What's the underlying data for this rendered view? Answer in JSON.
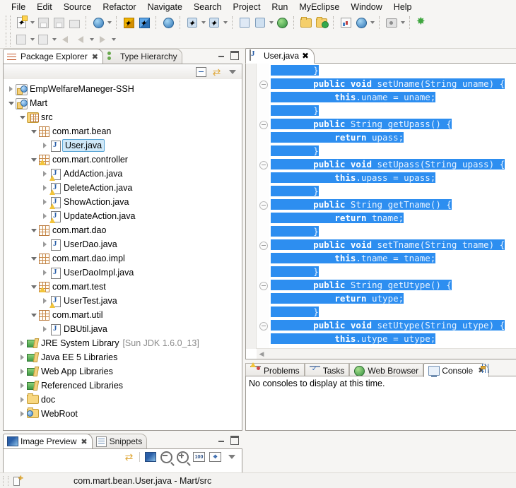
{
  "menubar": {
    "items": [
      "File",
      "Edit",
      "Source",
      "Refactor",
      "Navigate",
      "Search",
      "Project",
      "Run",
      "MyEclipse",
      "Window",
      "Help"
    ]
  },
  "toolbar": {
    "row1": [
      {
        "name": "new-wizard-button",
        "icon": "new-file-icon",
        "dropdown": true
      },
      {
        "name": "save-button",
        "icon": "save-icon",
        "dropdown": false
      },
      {
        "name": "save-all-button",
        "icon": "save-all-icon",
        "dropdown": false
      },
      {
        "name": "print-button",
        "icon": "print-icon",
        "dropdown": false
      },
      {
        "name": "build-button",
        "icon": "build-icon",
        "dropdown": true
      },
      {
        "name": "deploy-yellow-button",
        "icon": "yellow-cube-icon",
        "dropdown": false
      },
      {
        "name": "deploy-blue-button",
        "icon": "blue-cube-icon",
        "dropdown": false
      },
      {
        "name": "web-20-button",
        "icon": "web20-icon",
        "dropdown": false
      },
      {
        "name": "run-as-button",
        "icon": "run-person-icon",
        "dropdown": true
      },
      {
        "name": "debug-as-button",
        "icon": "debug-person-icon",
        "dropdown": true
      },
      {
        "name": "open-type-button",
        "icon": "open-type-icon",
        "dropdown": false
      },
      {
        "name": "run-server-button",
        "icon": "run-server-icon",
        "dropdown": true
      },
      {
        "name": "open-browser-button",
        "icon": "globe-icon",
        "dropdown": false
      },
      {
        "name": "open-resource-button",
        "icon": "open-folder-icon",
        "dropdown": false
      },
      {
        "name": "new-folder-button",
        "icon": "folder-plus-icon",
        "dropdown": false
      },
      {
        "name": "report-button",
        "icon": "report-icon",
        "dropdown": false
      },
      {
        "name": "browser-config-button",
        "icon": "globe-config-icon",
        "dropdown": true
      },
      {
        "name": "snapshot-button",
        "icon": "camera-icon",
        "dropdown": true
      },
      {
        "name": "myeclipse-button",
        "icon": "sparkle-icon",
        "dropdown": false
      }
    ],
    "row2": [
      {
        "name": "quick-fix-button",
        "icon": "quickfix-icon",
        "dropdown": true
      },
      {
        "name": "next-annotation-button",
        "icon": "annotation-icon",
        "dropdown": true
      },
      {
        "name": "back-history-button",
        "icon": "back-arrow-icon",
        "dropdown": false
      },
      {
        "name": "back-button",
        "icon": "left-arrow-icon",
        "dropdown": true
      },
      {
        "name": "forward-button",
        "icon": "right-arrow-icon",
        "dropdown": true
      }
    ]
  },
  "package_explorer": {
    "tabs": [
      {
        "label": "Package Explorer",
        "icon": "package-explorer-icon",
        "active": true,
        "closable": true
      },
      {
        "label": "Type Hierarchy",
        "icon": "type-hierarchy-icon",
        "active": false,
        "closable": false
      }
    ],
    "toolbar": [
      {
        "name": "collapse-all-button",
        "icon": "collapse-all-icon"
      },
      {
        "name": "link-with-editor-button",
        "icon": "link-editor-icon"
      },
      {
        "name": "view-menu-button",
        "icon": "view-menu-icon"
      }
    ],
    "tree": [
      {
        "label": "EmpWelfareManeger-SSH",
        "indent": 0,
        "twist": "closed",
        "icon": "java-project-icon",
        "selected": false,
        "sub": ""
      },
      {
        "label": "Mart",
        "indent": 0,
        "twist": "open",
        "icon": "java-project-icon",
        "selected": false,
        "sub": ""
      },
      {
        "label": "src",
        "indent": 1,
        "twist": "open",
        "icon": "source-folder-icon",
        "selected": false,
        "sub": ""
      },
      {
        "label": "com.mart.bean",
        "indent": 2,
        "twist": "open",
        "icon": "package-icon",
        "selected": false,
        "sub": ""
      },
      {
        "label": "User.java",
        "indent": 3,
        "twist": "closed",
        "icon": "java-file-icon",
        "selected": true,
        "sub": ""
      },
      {
        "label": "com.mart.controller",
        "indent": 2,
        "twist": "open",
        "icon": "package-warning-icon",
        "selected": false,
        "sub": ""
      },
      {
        "label": "AddAction.java",
        "indent": 3,
        "twist": "closed",
        "icon": "java-file-warning-icon",
        "selected": false,
        "sub": ""
      },
      {
        "label": "DeleteAction.java",
        "indent": 3,
        "twist": "closed",
        "icon": "java-file-warning-icon",
        "selected": false,
        "sub": ""
      },
      {
        "label": "ShowAction.java",
        "indent": 3,
        "twist": "closed",
        "icon": "java-file-warning-icon",
        "selected": false,
        "sub": ""
      },
      {
        "label": "UpdateAction.java",
        "indent": 3,
        "twist": "closed",
        "icon": "java-file-warning-icon",
        "selected": false,
        "sub": ""
      },
      {
        "label": "com.mart.dao",
        "indent": 2,
        "twist": "open",
        "icon": "package-icon",
        "selected": false,
        "sub": ""
      },
      {
        "label": "UserDao.java",
        "indent": 3,
        "twist": "closed",
        "icon": "java-file-icon",
        "selected": false,
        "sub": ""
      },
      {
        "label": "com.mart.dao.impl",
        "indent": 2,
        "twist": "open",
        "icon": "package-icon",
        "selected": false,
        "sub": ""
      },
      {
        "label": "UserDaoImpl.java",
        "indent": 3,
        "twist": "closed",
        "icon": "java-file-icon",
        "selected": false,
        "sub": ""
      },
      {
        "label": "com.mart.test",
        "indent": 2,
        "twist": "open",
        "icon": "package-warning-icon",
        "selected": false,
        "sub": ""
      },
      {
        "label": "UserTest.java",
        "indent": 3,
        "twist": "closed",
        "icon": "java-file-warning-icon",
        "selected": false,
        "sub": ""
      },
      {
        "label": "com.mart.util",
        "indent": 2,
        "twist": "open",
        "icon": "package-icon",
        "selected": false,
        "sub": ""
      },
      {
        "label": "DBUtil.java",
        "indent": 3,
        "twist": "closed",
        "icon": "java-file-icon",
        "selected": false,
        "sub": ""
      },
      {
        "label": "JRE System Library",
        "indent": 1,
        "twist": "closed",
        "icon": "library-icon",
        "selected": false,
        "sub": "[Sun JDK 1.6.0_13]"
      },
      {
        "label": "Java EE 5 Libraries",
        "indent": 1,
        "twist": "closed",
        "icon": "library-icon",
        "selected": false,
        "sub": ""
      },
      {
        "label": "Web App Libraries",
        "indent": 1,
        "twist": "closed",
        "icon": "library-icon",
        "selected": false,
        "sub": ""
      },
      {
        "label": "Referenced Libraries",
        "indent": 1,
        "twist": "closed",
        "icon": "library-icon",
        "selected": false,
        "sub": ""
      },
      {
        "label": "doc",
        "indent": 1,
        "twist": "closed",
        "icon": "folder-icon",
        "selected": false,
        "sub": ""
      },
      {
        "label": "WebRoot",
        "indent": 1,
        "twist": "closed",
        "icon": "webroot-folder-icon",
        "selected": false,
        "sub": ""
      }
    ]
  },
  "image_preview": {
    "tabs": [
      {
        "label": "Image Preview",
        "icon": "image-preview-icon",
        "active": true,
        "closable": true
      },
      {
        "label": "Snippets",
        "icon": "snippets-icon",
        "active": false,
        "closable": false
      }
    ],
    "toolbar": [
      {
        "name": "sync-button",
        "icon": "sync-icon"
      },
      {
        "name": "show-image-button",
        "icon": "image-icon"
      },
      {
        "name": "zoom-out-button",
        "icon": "zoom-out-icon"
      },
      {
        "name": "zoom-in-button",
        "icon": "zoom-in-icon"
      },
      {
        "name": "zoom-100-button",
        "icon": "zoom-100-icon",
        "label": "100"
      },
      {
        "name": "fit-image-button",
        "icon": "fit-image-icon"
      },
      {
        "name": "view-menu-button",
        "icon": "view-menu-icon"
      }
    ]
  },
  "editor": {
    "tab": {
      "label": "User.java",
      "icon": "java-file-icon",
      "closable": true
    },
    "selection_color": "#2d8ef0",
    "lines": [
      {
        "fold": false,
        "indent": 2,
        "tokens": [
          {
            "t": "}",
            "k": "plain"
          }
        ]
      },
      {
        "fold": true,
        "indent": 2,
        "tokens": [
          {
            "t": "public void ",
            "k": "kw"
          },
          {
            "t": "setUname(String uname) {",
            "k": "plain"
          }
        ]
      },
      {
        "fold": false,
        "indent": 3,
        "tokens": [
          {
            "t": "this",
            "k": "kw"
          },
          {
            "t": ".uname = uname;",
            "k": "plain"
          }
        ]
      },
      {
        "fold": false,
        "indent": 2,
        "tokens": [
          {
            "t": "}",
            "k": "plain"
          }
        ]
      },
      {
        "fold": true,
        "indent": 2,
        "tokens": [
          {
            "t": "public ",
            "k": "kw"
          },
          {
            "t": "String getUpass() {",
            "k": "plain"
          }
        ]
      },
      {
        "fold": false,
        "indent": 3,
        "tokens": [
          {
            "t": "return ",
            "k": "kw"
          },
          {
            "t": "upass;",
            "k": "plain"
          }
        ]
      },
      {
        "fold": false,
        "indent": 2,
        "tokens": [
          {
            "t": "}",
            "k": "plain"
          }
        ]
      },
      {
        "fold": true,
        "indent": 2,
        "tokens": [
          {
            "t": "public void ",
            "k": "kw"
          },
          {
            "t": "setUpass(String upass) {",
            "k": "plain"
          }
        ]
      },
      {
        "fold": false,
        "indent": 3,
        "tokens": [
          {
            "t": "this",
            "k": "kw"
          },
          {
            "t": ".upass = upass;",
            "k": "plain"
          }
        ]
      },
      {
        "fold": false,
        "indent": 2,
        "tokens": [
          {
            "t": "}",
            "k": "plain"
          }
        ]
      },
      {
        "fold": true,
        "indent": 2,
        "tokens": [
          {
            "t": "public ",
            "k": "kw"
          },
          {
            "t": "String getTname() {",
            "k": "plain"
          }
        ]
      },
      {
        "fold": false,
        "indent": 3,
        "tokens": [
          {
            "t": "return ",
            "k": "kw"
          },
          {
            "t": "tname;",
            "k": "plain"
          }
        ]
      },
      {
        "fold": false,
        "indent": 2,
        "tokens": [
          {
            "t": "}",
            "k": "plain"
          }
        ]
      },
      {
        "fold": true,
        "indent": 2,
        "tokens": [
          {
            "t": "public void ",
            "k": "kw"
          },
          {
            "t": "setTname(String tname) {",
            "k": "plain"
          }
        ]
      },
      {
        "fold": false,
        "indent": 3,
        "tokens": [
          {
            "t": "this",
            "k": "kw"
          },
          {
            "t": ".tname = tname;",
            "k": "plain"
          }
        ]
      },
      {
        "fold": false,
        "indent": 2,
        "tokens": [
          {
            "t": "}",
            "k": "plain"
          }
        ]
      },
      {
        "fold": true,
        "indent": 2,
        "tokens": [
          {
            "t": "public ",
            "k": "kw"
          },
          {
            "t": "String getUtype() {",
            "k": "plain"
          }
        ]
      },
      {
        "fold": false,
        "indent": 3,
        "tokens": [
          {
            "t": "return ",
            "k": "kw"
          },
          {
            "t": "utype;",
            "k": "plain"
          }
        ]
      },
      {
        "fold": false,
        "indent": 2,
        "tokens": [
          {
            "t": "}",
            "k": "plain"
          }
        ]
      },
      {
        "fold": true,
        "indent": 2,
        "tokens": [
          {
            "t": "public void ",
            "k": "kw"
          },
          {
            "t": "setUtype(String utype) {",
            "k": "plain"
          }
        ]
      },
      {
        "fold": false,
        "indent": 3,
        "tokens": [
          {
            "t": "this",
            "k": "kw"
          },
          {
            "t": ".utype = utype;",
            "k": "plain"
          }
        ]
      }
    ]
  },
  "bottom_panel": {
    "tabs": [
      {
        "label": "Problems",
        "icon": "problems-icon",
        "active": false,
        "closable": false
      },
      {
        "label": "Tasks",
        "icon": "tasks-icon",
        "active": false,
        "closable": false
      },
      {
        "label": "Web Browser",
        "icon": "web-browser-icon",
        "active": false,
        "closable": false
      },
      {
        "label": "Console",
        "icon": "console-icon",
        "active": true,
        "closable": true
      }
    ],
    "toolbar": [
      {
        "name": "console-options-button",
        "icon": "console-options-icon"
      }
    ],
    "message": "No consoles to display at this time."
  },
  "statusbar": {
    "icon": "writable-icon",
    "text": "com.mart.bean.User.java - Mart/src"
  }
}
